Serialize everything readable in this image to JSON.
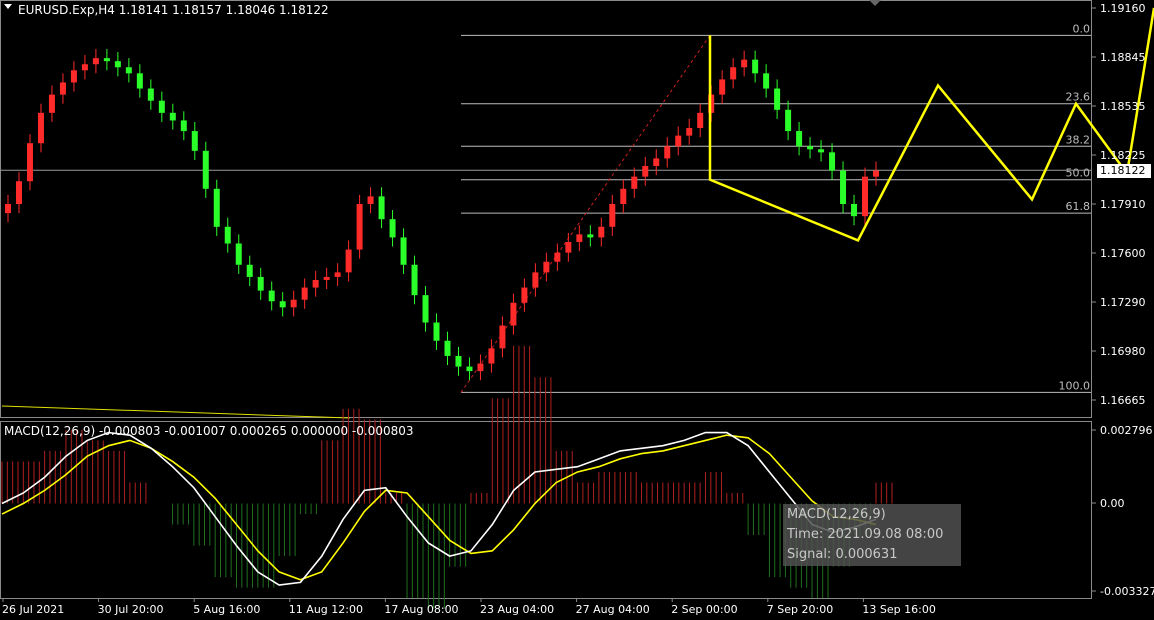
{
  "header": {
    "symbol_line": "EURUSD.Exp,H4  1.18141 1.18157 1.18046 1.18122",
    "macd_line": "MACD(12,26,9) -0.000803 -0.001007 0.000265 0.000000 -0.000803"
  },
  "price_axis": {
    "ticks": [
      "1.19160",
      "1.18845",
      "1.18535",
      "1.18225",
      "1.17910",
      "1.17600",
      "1.17290",
      "1.16980",
      "1.16665"
    ],
    "current": "1.18122"
  },
  "macd_axis": {
    "ticks": [
      "0.002796",
      "0.00",
      "-0.003327"
    ]
  },
  "time_axis": {
    "ticks": [
      "26 Jul 2021",
      "30 Jul 20:00",
      "5 Aug 16:00",
      "11 Aug 12:00",
      "17 Aug 08:00",
      "23 Aug 04:00",
      "27 Aug 04:00",
      "2 Sep 00:00",
      "7 Sep 20:00",
      "13 Sep 16:00"
    ]
  },
  "fibo": {
    "levels": [
      "0.0",
      "23.6",
      "38.2",
      "50.0",
      "61.8",
      "100.0"
    ]
  },
  "tooltip": {
    "line1": "MACD(12,26,9)",
    "line2": "Time: 2021.09.08 08:00",
    "line3": "Signal: 0.000631"
  },
  "colors": {
    "bull": "#ff2a2a",
    "bear": "#2aff2a",
    "yellow": "#ffff00",
    "grid": "#8a8a8a",
    "hist_pos": "#b02020",
    "hist_neg": "#207020"
  },
  "chart_data": {
    "type": "candlestick",
    "symbol": "EURUSD.Exp",
    "timeframe": "H4",
    "ylim": [
      1.1661,
      1.1919
    ],
    "closes": [
      1.179,
      1.1805,
      1.183,
      1.185,
      1.1862,
      1.187,
      1.1878,
      1.1882,
      1.1886,
      1.1884,
      1.188,
      1.1876,
      1.1866,
      1.1858,
      1.185,
      1.1845,
      1.1838,
      1.1825,
      1.18,
      1.1775,
      1.1764,
      1.175,
      1.1742,
      1.1733,
      1.1726,
      1.1722,
      1.1727,
      1.1735,
      1.174,
      1.1742,
      1.1745,
      1.176,
      1.179,
      1.1795,
      1.178,
      1.1768,
      1.175,
      1.173,
      1.1712,
      1.17,
      1.169,
      1.1683,
      1.168,
      1.1685,
      1.1695,
      1.171,
      1.1725,
      1.1735,
      1.1745,
      1.1752,
      1.1758,
      1.1765,
      1.177,
      1.1768,
      1.1775,
      1.179,
      1.18,
      1.1808,
      1.1815,
      1.182,
      1.1828,
      1.1835,
      1.184,
      1.185,
      1.1862,
      1.1872,
      1.188,
      1.1885,
      1.1876,
      1.1866,
      1.1852,
      1.1838,
      1.1828,
      1.1826,
      1.1824,
      1.1812,
      1.179,
      1.1782,
      1.1808,
      1.1812
    ],
    "macd": [
      0.0,
      0.0004,
      0.001,
      0.0018,
      0.0024,
      0.0027,
      0.0026,
      0.0021,
      0.0014,
      0.0006,
      -0.0005,
      -0.0016,
      -0.0026,
      -0.0031,
      -0.003,
      -0.002,
      -0.0006,
      0.0005,
      0.0006,
      -0.0005,
      -0.0015,
      -0.002,
      -0.0018,
      -0.0008,
      0.0005,
      0.0012,
      0.0013,
      0.0014,
      0.0017,
      0.002,
      0.0021,
      0.0022,
      0.0024,
      0.0027,
      0.0027,
      0.0022,
      0.0012,
      0.0002,
      -0.0008,
      -0.0011,
      -0.0009,
      -0.0006
    ],
    "signal": [
      -0.0004,
      0.0,
      0.0005,
      0.0011,
      0.0018,
      0.0022,
      0.0024,
      0.0021,
      0.0016,
      0.001,
      0.0002,
      -0.0008,
      -0.0018,
      -0.0026,
      -0.0029,
      -0.0026,
      -0.0015,
      -0.0003,
      0.0005,
      0.0004,
      -0.0005,
      -0.0014,
      -0.0019,
      -0.0018,
      -0.001,
      0.0,
      0.0008,
      0.0012,
      0.0014,
      0.0017,
      0.0019,
      0.002,
      0.0022,
      0.0024,
      0.0026,
      0.0025,
      0.0019,
      0.001,
      0.0001,
      -0.0005,
      -0.0006,
      -0.0008
    ],
    "fibo_prices": [
      1.1901,
      1.1856,
      1.1828,
      1.1806,
      1.1784,
      1.1666
    ],
    "projection_path": [
      1.1806,
      1.1766,
      1.1868,
      1.1793,
      1.1856,
      1.181,
      1.1919
    ]
  }
}
